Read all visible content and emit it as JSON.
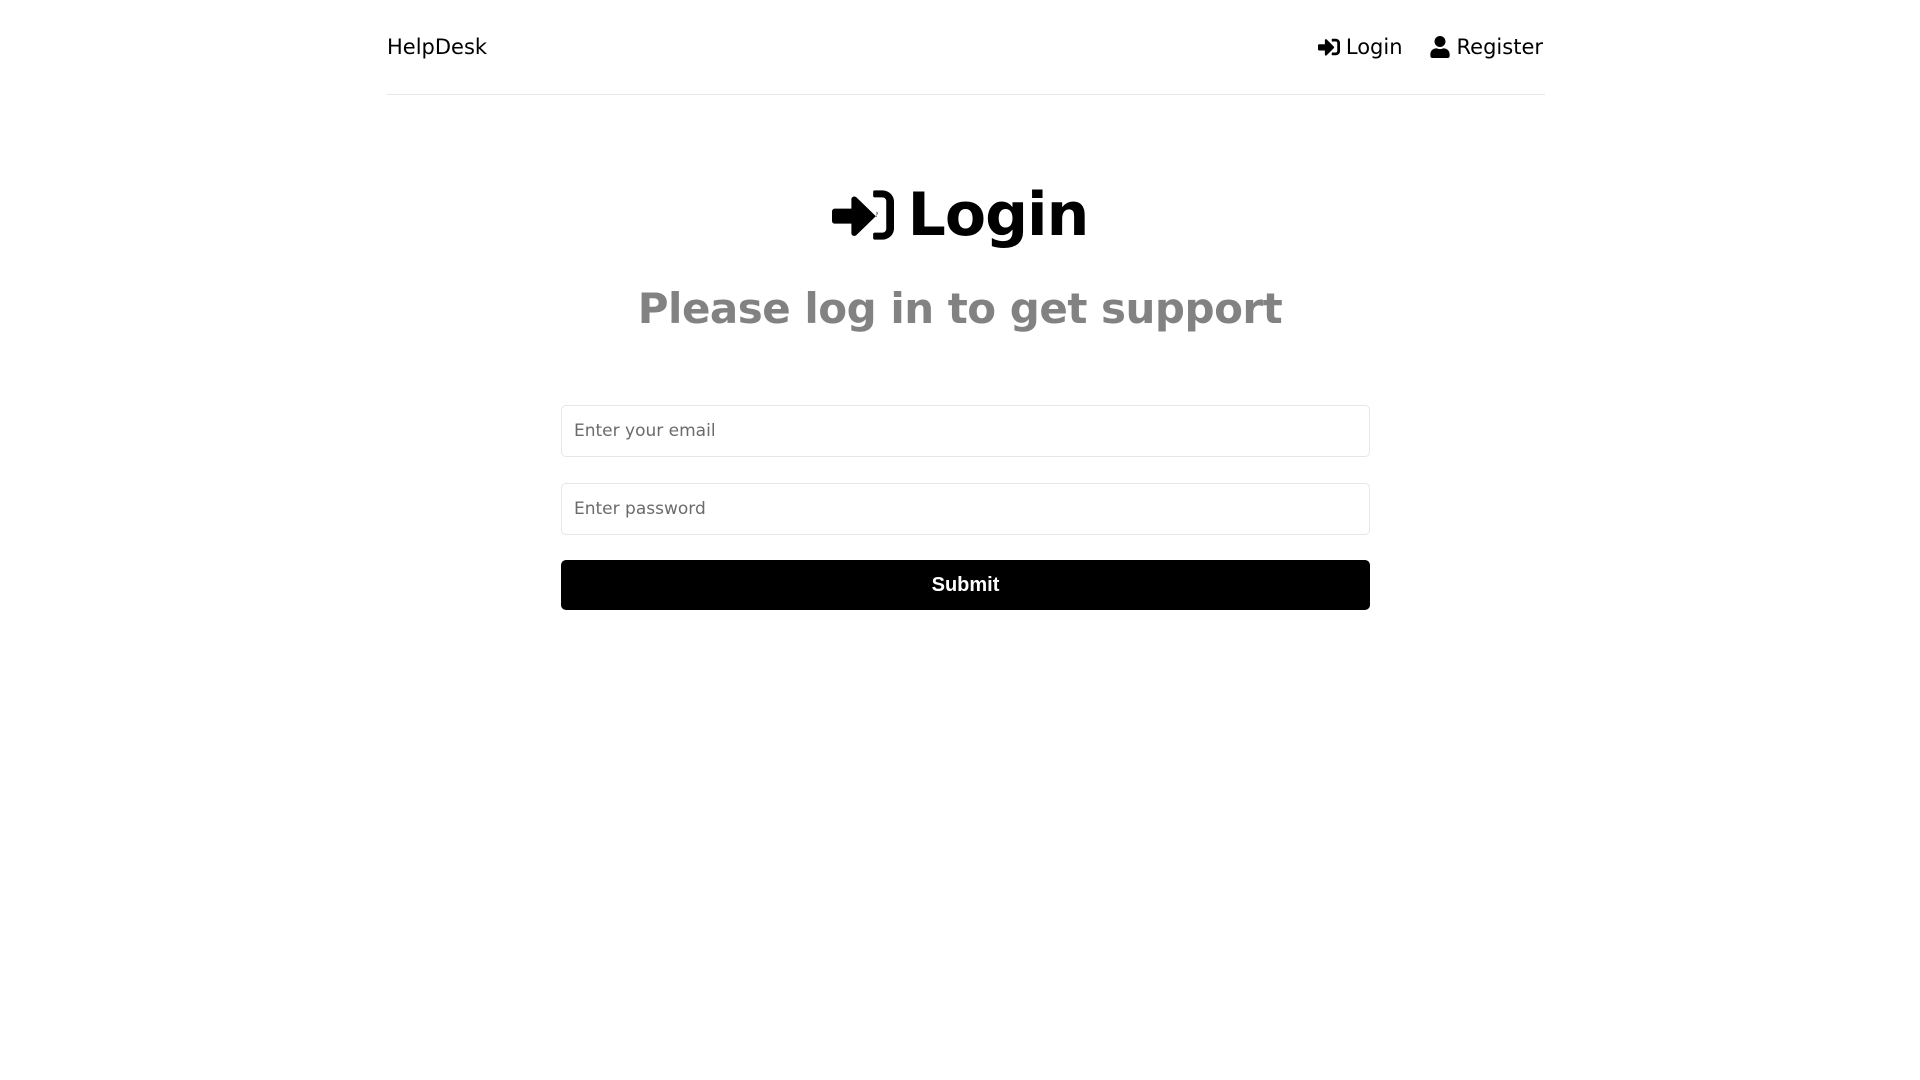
{
  "header": {
    "brand": "HelpDesk",
    "nav": {
      "login_label": "Login",
      "login_icon": "sign-in-icon",
      "register_label": "Register",
      "register_icon": "user-icon"
    }
  },
  "main": {
    "title": "Login",
    "title_icon": "sign-in-icon",
    "subtitle": "Please log in to get support"
  },
  "form": {
    "email": {
      "value": "",
      "placeholder": "Enter your email"
    },
    "password": {
      "value": "",
      "placeholder": "Enter password"
    },
    "submit_label": "Submit"
  },
  "colors": {
    "primary": "#000000",
    "subtitle": "#828282",
    "border": "#e6e6e6",
    "background": "#ffffff"
  }
}
